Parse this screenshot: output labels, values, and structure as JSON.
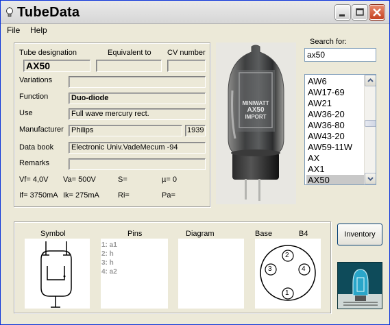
{
  "window": {
    "title": "TubeData",
    "accent": "#0831d9"
  },
  "menu": {
    "items": [
      "File",
      "Help"
    ]
  },
  "details": {
    "headers": {
      "designation": "Tube designation",
      "equivalent": "Equivalent to",
      "cv": "CV number"
    },
    "designation": "AX50",
    "equivalent": "",
    "cv_number": "",
    "labels": {
      "variations": "Variations",
      "function": "Function",
      "use": "Use",
      "manufacturer": "Manufacturer",
      "data_book": "Data book",
      "remarks": "Remarks"
    },
    "variations": "",
    "function": "Duo-diode",
    "use": "Full wave mercury rect.",
    "manufacturer": "Philips",
    "year": "1939",
    "data_book": "Electronic Univ.VadeMecum -94",
    "remarks": "",
    "params": {
      "vf": "Vf= 4,0V",
      "va": "Va= 500V",
      "s": "S=",
      "mu": "µ=   0",
      "if": "If= 3750mA",
      "ik": "Ik=   275mA",
      "ri": "Ri=",
      "pa": "Pa="
    }
  },
  "photo": {
    "glass_text": [
      "MINIWATT",
      "AX50",
      "IMPORT"
    ]
  },
  "search": {
    "label": "Search for:",
    "value": "ax50",
    "results": [
      "AW6",
      "AW17-69",
      "AW21",
      "AW36-20",
      "AW36-80",
      "AW43-20",
      "AW59-11W",
      "AX",
      "AX1",
      "AX50"
    ],
    "selected": "AX50"
  },
  "bottom": {
    "headers": {
      "symbol": "Symbol",
      "pins": "Pins",
      "diagram": "Diagram",
      "base": "Base",
      "base_type": "B4"
    },
    "pins": [
      "1: a1",
      "2: h",
      "3: h",
      "4: a2"
    ],
    "base_pins": [
      "1",
      "2",
      "3",
      "4"
    ]
  },
  "buttons": {
    "inventory": "Inventory"
  }
}
